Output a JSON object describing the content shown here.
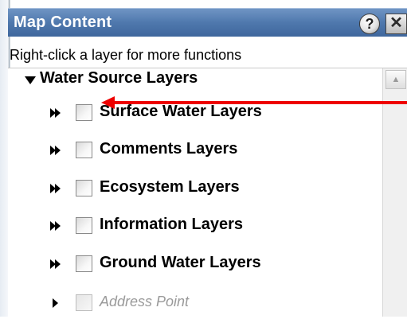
{
  "panel": {
    "title": "Map Content",
    "help_icon": "question-mark-icon",
    "close_icon": "close-icon",
    "instructions": "Right-click a layer for more functions"
  },
  "tree": {
    "group_label": "Water Source Layers",
    "group_expanded": true,
    "layers": [
      {
        "label": "Surface Water Layers",
        "checked": false,
        "expander": "double-chevron-right-icon"
      },
      {
        "label": "Comments Layers",
        "checked": false,
        "expander": "double-chevron-right-icon"
      },
      {
        "label": "Ecosystem Layers",
        "checked": false,
        "expander": "double-chevron-right-icon"
      },
      {
        "label": "Information Layers",
        "checked": false,
        "expander": "double-chevron-right-icon"
      },
      {
        "label": "Ground Water Layers",
        "checked": false,
        "expander": "double-chevron-right-icon"
      },
      {
        "label": "Address Point",
        "checked": false,
        "expander": "triangle-right-icon",
        "disabled": true
      }
    ]
  },
  "annotation": {
    "arrow_color": "#ee0000"
  },
  "colors": {
    "titlebar": "#4f78ad",
    "title_text": "#ffffff"
  }
}
